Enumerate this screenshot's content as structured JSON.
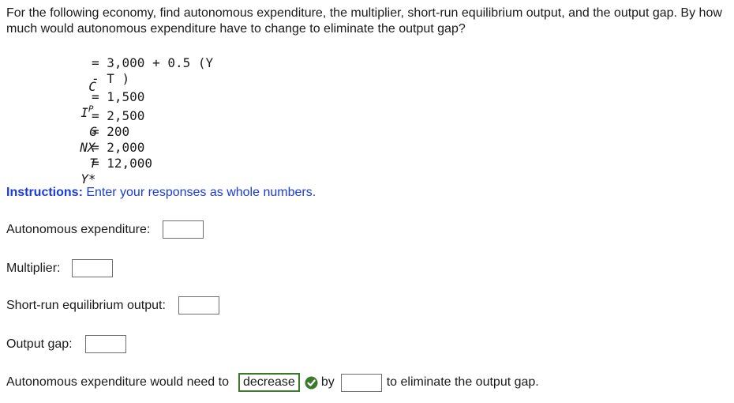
{
  "question": "For the following economy, find autonomous expenditure, the multiplier, short-run equilibrium output, and the output gap. By how much would autonomous expenditure have to change to eliminate the output gap?",
  "equations": {
    "c_var": "C",
    "c_rhs_line1": "= 3,000 + 0.5 (Y",
    "c_rhs_line2": "- T )",
    "ip_var": "I",
    "ip_sup": "P",
    "ip_rhs": "= 1,500",
    "g_var": "G",
    "g_rhs": "= 2,500",
    "nx_var": "NX",
    "nx_rhs": "= 200",
    "t_var": "T",
    "t_rhs": "= 2,000",
    "ystar_var": "Y*",
    "ystar_rhs": "= 12,000"
  },
  "instructions": {
    "label": "Instructions:",
    "text": " Enter your responses as whole numbers."
  },
  "fields": {
    "autonomous_expenditure_label": "Autonomous expenditure:",
    "multiplier_label": "Multiplier:",
    "short_run_output_label": "Short-run equilibrium output:",
    "output_gap_label": "Output gap:"
  },
  "final": {
    "prefix": "Autonomous expenditure would need to",
    "selected": "decrease",
    "by": "by",
    "suffix": "to eliminate the output gap."
  },
  "colors": {
    "instructions": "#1a3adb",
    "select_border": "#3a7a2a",
    "check": "#3a7a2a"
  }
}
